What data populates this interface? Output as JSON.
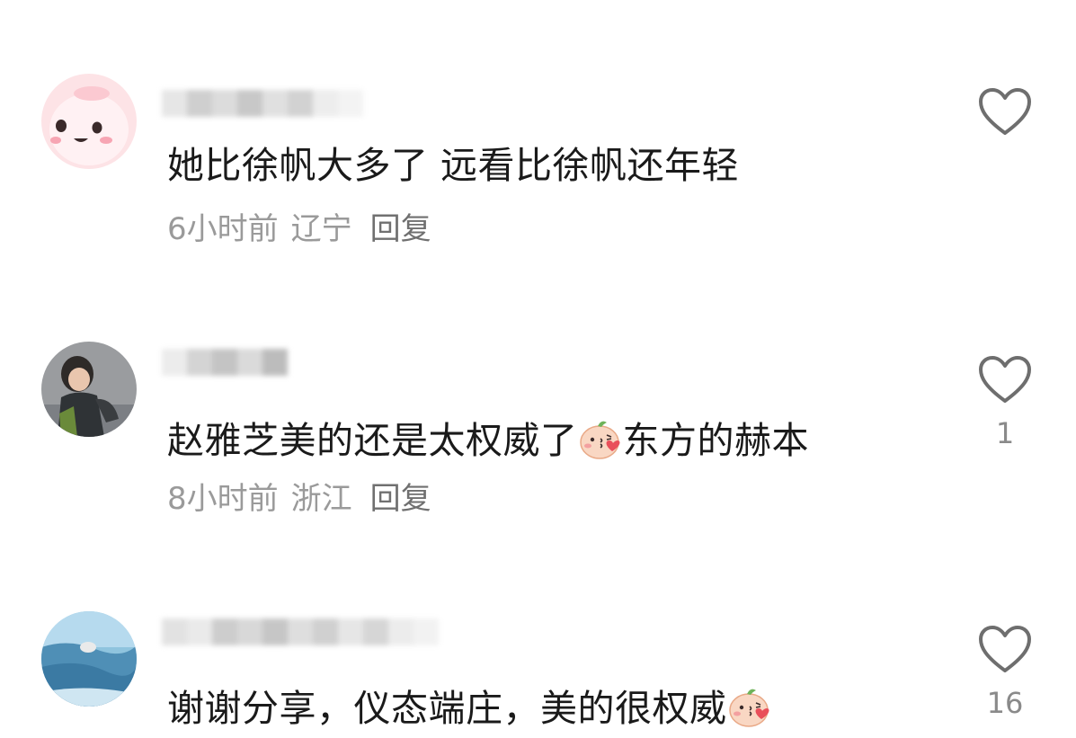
{
  "comments": [
    {
      "text_before": "她比徐帆大多了 远看比徐帆还年轻",
      "emoji_mid": "",
      "text_after": "",
      "time": "6小时前",
      "location": "辽宁",
      "reply_label": "回复",
      "like_count": "",
      "avatar": "pink-cartoon-avatar"
    },
    {
      "text_before": "赵雅芝美的还是太权威了",
      "emoji_mid": "kiss-emoji",
      "text_after": "东方的赫本",
      "time": "8小时前",
      "location": "浙江",
      "reply_label": "回复",
      "like_count": "1",
      "avatar": "child-photo-avatar"
    },
    {
      "text_before": "谢谢分享，仪态端庄，美的很权威",
      "emoji_mid": "kiss-emoji",
      "text_after": "",
      "time": "",
      "location": "",
      "reply_label": "",
      "like_count": "16",
      "avatar": "landscape-avatar"
    }
  ],
  "colors": {
    "text": "#1a1a1a",
    "meta": "#9a9a9a",
    "icon": "#6e6e6e",
    "background": "#ffffff"
  }
}
